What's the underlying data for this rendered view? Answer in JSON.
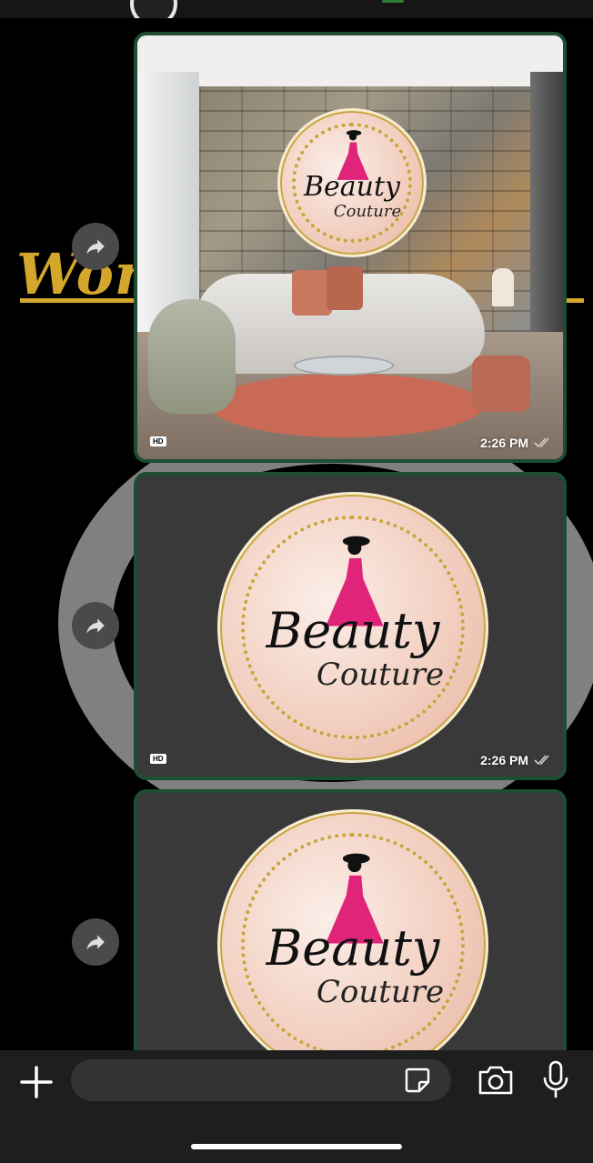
{
  "wallpaper": {
    "text": "Wor",
    "colors": {
      "gold": "#d4a72c",
      "ring": "#8e8e8e"
    }
  },
  "messages": [
    {
      "hd_label": "HD",
      "time": "2:26 PM",
      "status": "read-ticks",
      "image": "room-with-beauty-couture-logo"
    },
    {
      "hd_label": "HD",
      "time": "2:26 PM",
      "status": "read-ticks",
      "image": "beauty-couture-logo"
    },
    {
      "image": "beauty-couture-logo"
    }
  ],
  "logo": {
    "line1": "Beauty",
    "line2": "Couture",
    "colors": {
      "pink": "#e0247a",
      "gold": "#c9a43a",
      "blush": "#f2cfc0"
    }
  },
  "composer": {
    "placeholder": "",
    "icons": [
      "plus-icon",
      "sticker-icon",
      "camera-icon",
      "microphone-icon"
    ]
  },
  "theme": {
    "bubble_border": "#1d4d33",
    "bubble_bg": "#3a3939",
    "composer_bg": "#1e1e1e"
  }
}
